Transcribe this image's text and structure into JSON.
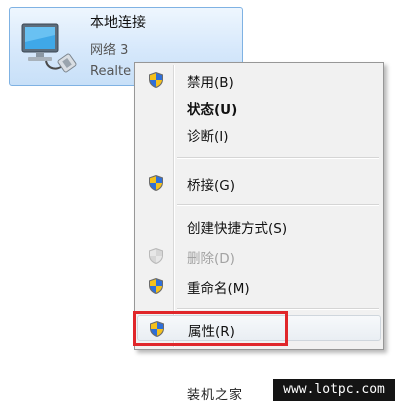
{
  "adapter": {
    "name": "本地连接",
    "network": "网络  3",
    "device": "Realte"
  },
  "context_menu": {
    "items": [
      {
        "label": "禁用(B)",
        "icon": "uac-shield-icon"
      },
      {
        "label": "状态(U)",
        "bold": true
      },
      {
        "label": "诊断(I)"
      },
      {
        "label": "桥接(G)",
        "icon": "uac-shield-icon"
      },
      {
        "label": "创建快捷方式(S)"
      },
      {
        "label": "删除(D)",
        "icon": "uac-shield-icon",
        "disabled": true
      },
      {
        "label": "重命名(M)",
        "icon": "uac-shield-icon"
      },
      {
        "label": "属性(R)",
        "icon": "uac-shield-icon",
        "hovered": true
      }
    ]
  },
  "annotation": {
    "highlight_color": "#e0262a"
  },
  "watermark": {
    "text": "装机之家",
    "url": "www.lotpc.com"
  }
}
